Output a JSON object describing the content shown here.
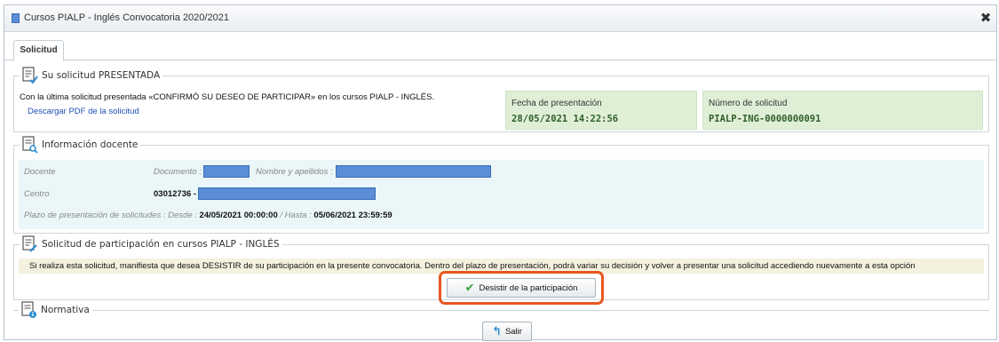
{
  "window": {
    "title": "Cursos PIALP - Inglés Convocatoria 2020/2021",
    "close_label": "✖"
  },
  "tabs": [
    {
      "label": "Solicitud",
      "active": true
    }
  ],
  "section_submitted": {
    "title": "Su solicitud PRESENTADA",
    "message": "Con la última solicitud presentada «CONFIRMÓ SU DESEO DE PARTICIPAR» en los cursos PIALP - INGLÉS.",
    "pdf_link": "Descargar PDF de la solicitud",
    "date_label": "Fecha de presentación",
    "date_value": "28/05/2021 14:22:56",
    "number_label": "Número de solicitud",
    "number_value": "PIALP-ING-0000000091"
  },
  "section_teacher": {
    "title": "Información docente",
    "docente_label": "Docente",
    "documento_label": "Documento :",
    "nombre_label": "Nombre y apellidos :",
    "centro_label": "Centro",
    "centro_code": "03012736 -",
    "plazo_label": "Plazo de presentación de solicitudes :",
    "desde_label": "Desde :",
    "desde_value": "24/05/2021 00:00:00",
    "separator": "/",
    "hasta_label": "Hasta :",
    "hasta_value": "05/06/2021 23:59:59"
  },
  "section_participation": {
    "title": "Solicitud de participación en cursos PIALP - INGLÉS",
    "notice": "Si realiza esta solicitud, manifiesta que desea DESISTIR de su participación en la presente convocatoria. Dentro del plazo de presentación, podrá variar su decisión y volver a presentar una solicitud accediendo nuevamente a esta opción",
    "button_label": "Desistir de la participación"
  },
  "section_normativa": {
    "title": "Normativa"
  },
  "footer": {
    "exit_label": "Salir"
  },
  "colors": {
    "info_green_bg": "#dfefd6",
    "info_green_text": "#2f5d2a",
    "teacher_bg": "#eaf6f8",
    "notice_bg": "#f4f1de",
    "highlight": "#e9561f",
    "link": "#1f4fb5"
  }
}
